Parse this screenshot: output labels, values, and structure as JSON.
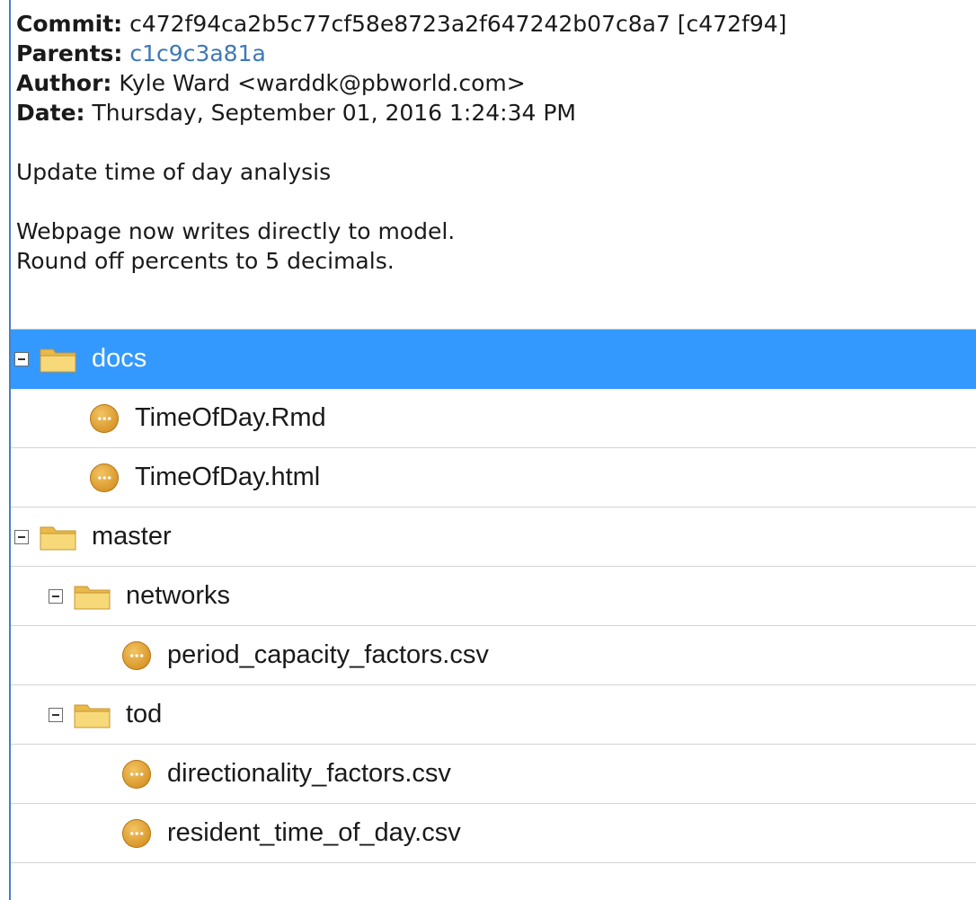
{
  "commit": {
    "commit_label": "Commit:",
    "commit_value": "c472f94ca2b5c77cf58e8723a2f647242b07c8a7 [c472f94]",
    "parents_label": "Parents:",
    "parents_value": "c1c9c3a81a",
    "author_label": "Author:",
    "author_value": "Kyle Ward <warddk@pbworld.com>",
    "date_label": "Date:",
    "date_value": "Thursday, September 01, 2016 1:24:34 PM",
    "message_subject": "Update time of day analysis",
    "message_body_line1": "Webpage now writes directly to model.",
    "message_body_line2": "Round off percents to 5 decimals."
  },
  "tree": {
    "docs": "docs",
    "docs_files": [
      "TimeOfDay.Rmd",
      "TimeOfDay.html"
    ],
    "master": "master",
    "networks": "networks",
    "networks_files": [
      "period_capacity_factors.csv"
    ],
    "tod": "tod",
    "tod_files": [
      "directionality_factors.csv",
      "resident_time_of_day.csv"
    ]
  },
  "colors": {
    "selection": "#3399ff",
    "link": "#3d78b8",
    "frame": "#4a7fc0",
    "folder": "#f2cd6b",
    "file_icon": "#d9962a"
  }
}
